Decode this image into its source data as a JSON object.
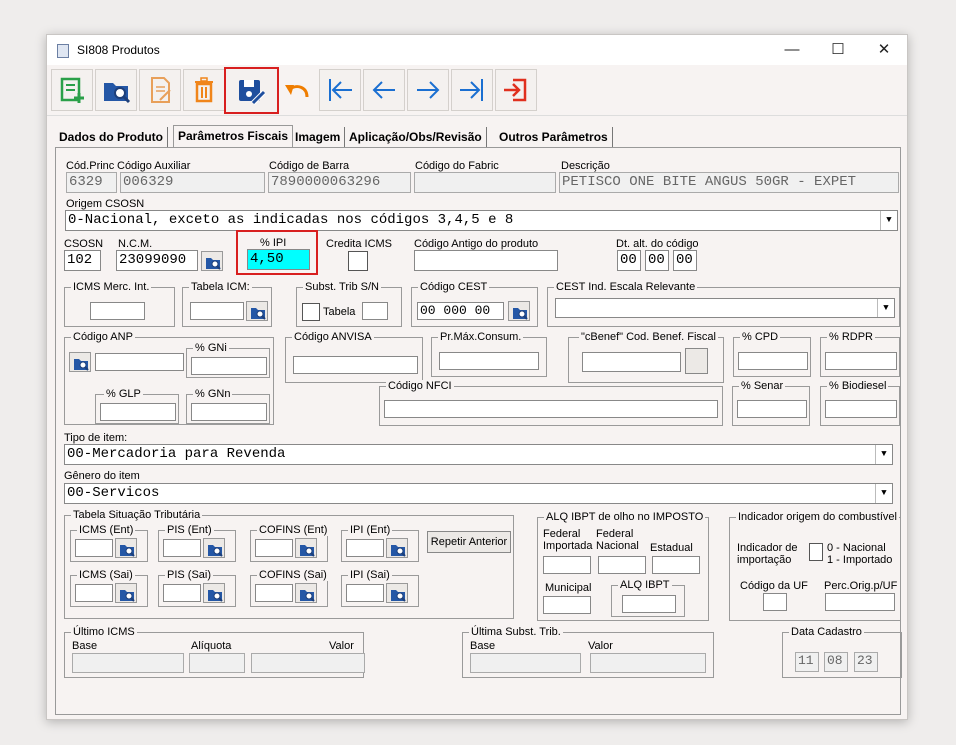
{
  "window": {
    "title": "SI808 Produtos",
    "minimize": "—",
    "maximize": "☐",
    "close": "✕"
  },
  "toolbar": [
    "new-record",
    "search-record",
    "edit-record",
    "delete-record",
    "save-record",
    "undo",
    "first-record",
    "previous-record",
    "next-record",
    "last-record",
    "exit"
  ],
  "tabs": [
    "Dados do  Produto",
    "Parâmetros Fiscais",
    "Imagem",
    "Aplicação/Obs/Revisão",
    "Outros Parâmetros"
  ],
  "header": {
    "cod_princ_label": "Cód.Princ",
    "cod_princ": "6329",
    "cod_aux_label": "Código Auxiliar",
    "cod_aux": "006329",
    "cod_barra_label": "Código de Barra",
    "cod_barra": "7890000063296",
    "cod_fabric_label": "Código do Fabric",
    "cod_fabric": "",
    "descricao_label": "Descrição",
    "descricao": "PETISCO ONE BITE ANGUS 50GR - EXPET"
  },
  "origem": {
    "label": "Origem CSOSN",
    "value": "0-Nacional, exceto as indicadas nos códigos 3,4,5 e 8"
  },
  "row3": {
    "csosn_label": "CSOSN",
    "csosn": "102",
    "ncm_label": "N.C.M.",
    "ncm": "23099090",
    "ipi_label": "% IPI",
    "ipi": "4,50",
    "credita_icms_label": "Credita ICMS",
    "cod_antigo_label": "Código Antigo do produto",
    "cod_antigo": "",
    "dt_alt_label": "Dt. alt. do código",
    "dt_alt": [
      "00",
      "00",
      "00"
    ]
  },
  "row4": {
    "icms_merc_label": "ICMS Merc. Int.",
    "tabela_icm_label": "Tabela ICM:",
    "subst_label": "Subst. Trib S/N",
    "tabela_label": "Tabela",
    "cest_label": "Código CEST",
    "cest": "00 000 00",
    "cest_ind_label": "CEST Ind. Escala Relevante"
  },
  "row5": {
    "anp_label": "Código ANP",
    "gni_label": "% GNi",
    "glp_label": "% GLP",
    "gnn_label": "% GNn",
    "anvisa_label": "Código ANVISA",
    "prmax_label": "Pr.Máx.Consum.",
    "cbenef_label": "\"cBenef\" Cod. Benef. Fiscal",
    "cpd_label": "% CPD",
    "rdpr_label": "% RDPR",
    "nfci_label": "Código NFCI",
    "senar_label": "% Senar",
    "biodiesel_label": "% Biodiesel"
  },
  "tipo_item": {
    "label": "Tipo de item:",
    "value": "00-Mercadoria para Revenda"
  },
  "genero_item": {
    "label": "Gênero do item",
    "value": "00-Servicos"
  },
  "tst": {
    "label": "Tabela Situação Tributária",
    "icms_ent": "ICMS (Ent)",
    "pis_ent": "PIS (Ent)",
    "cofins_ent": "COFINS (Ent)",
    "ipi_ent": "IPI (Ent)",
    "icms_sai": "ICMS (Sai)",
    "pis_sai": "PIS (Sai)",
    "cofins_sai": "COFINS (Sai)",
    "ipi_sai": "IPI (Sai)",
    "repetir": "Repetir Anterior"
  },
  "ibpt": {
    "label": "ALQ IBPT de olho no IMPOSTO",
    "federal_importada": "Federal\nImportada",
    "federal_nacional": "Federal\nNacional",
    "estadual": "Estadual",
    "municipal": "Municipal",
    "alq_ibpt": "ALQ IBPT"
  },
  "comb": {
    "label": "Indicador origem do combustível",
    "ind_importacao": "Indicador de\nimportação",
    "options": "0 - Nacional\n1 - Importado",
    "cod_uf": "Código da UF",
    "perc_orig": "Perc.Orig.p/UF"
  },
  "ultimo_icms": {
    "label": "Último ICMS",
    "base": "Base",
    "aliquota": "Alíquota",
    "valor": "Valor"
  },
  "ultima_st": {
    "label": "Última Subst. Trib.",
    "base": "Base",
    "valor": "Valor"
  },
  "data_cadastro": {
    "label": "Data Cadastro",
    "values": [
      "11",
      "08",
      "23"
    ]
  },
  "colors": {
    "highlight": "#d81f1f",
    "accent_blue": "#1a6fd1",
    "ipi_field": "#00ffff"
  }
}
